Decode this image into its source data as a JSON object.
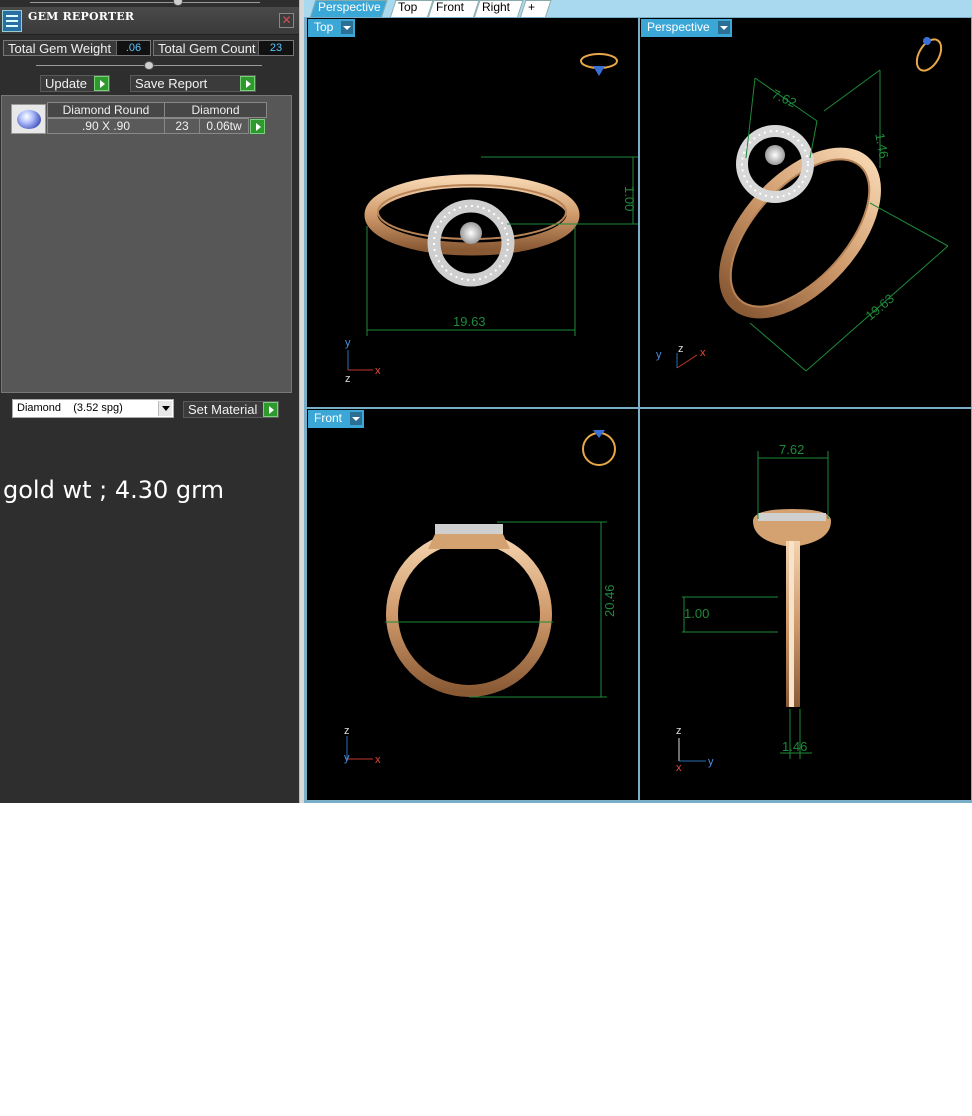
{
  "panel": {
    "title": "GEM REPORTER",
    "close_glyph": "✕",
    "total_gem_weight_label": "Total Gem Weight",
    "total_gem_weight_value": ".06",
    "total_gem_count_label": "Total Gem Count",
    "total_gem_count_value": "23",
    "update_label": "Update",
    "save_report_label": "Save Report",
    "gem_row": {
      "name": "Diamond Round",
      "material": "Diamond",
      "size": ".90 X .90",
      "count": "23",
      "weight": "0.06tw"
    },
    "material_select_value": "Diamond    (3.52 spg)",
    "set_material_label": "Set Material"
  },
  "note": "gold wt ; 4.30 grm",
  "tabs": [
    {
      "label": "Perspective",
      "active": true
    },
    {
      "label": "Top"
    },
    {
      "label": "Front"
    },
    {
      "label": "Right"
    },
    {
      "label": "+"
    }
  ],
  "viewports": {
    "top": {
      "label": "Top",
      "dim_width": "19.63",
      "dim_small": "1.00",
      "axis_y": "y",
      "axis_x": "x",
      "axis_z": "z"
    },
    "perspective": {
      "label": "Perspective",
      "dim_head": "7.62",
      "dim_width": "19.63",
      "dim_small": "1.46",
      "axis_y": "y",
      "axis_z": "z",
      "axis_x": "x"
    },
    "front": {
      "label": "Front",
      "dim_height": "20.46",
      "axis_z": "z",
      "axis_y": "y",
      "axis_x": "x"
    },
    "right": {
      "dim_head": "7.62",
      "dim_small": "1.00",
      "dim_band": "1.46",
      "axis_z": "z",
      "axis_x": "x",
      "axis_y": "y"
    }
  },
  "colors": {
    "accent": "#3aa7d6",
    "dimension": "#1e8a3a",
    "gold": "#e0b58e",
    "panel_bg": "#2e2e2e",
    "value_text": "#5fc4ff"
  }
}
